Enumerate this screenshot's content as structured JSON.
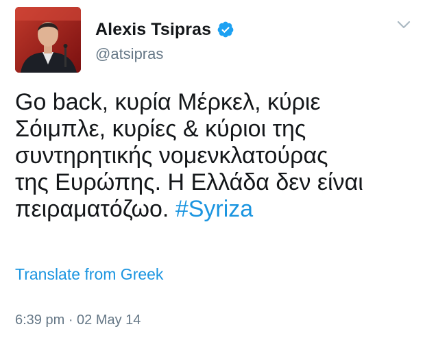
{
  "user": {
    "display_name": "Alexis Tsipras",
    "handle": "@atsipras",
    "verified": true
  },
  "tweet": {
    "lines": [
      "Go back, κυρία Μέρκελ, κύριε",
      "Σόιμπλε, κυρίες & κύριοι της",
      "συντηρητικής νομενκλατούρας",
      "της Ευρώπης. Η Ελλάδα δεν είναι"
    ],
    "last_line_text": "πειραματόζωο. ",
    "hashtag": "#Syriza"
  },
  "translate_label": "Translate from Greek",
  "timestamp": "6:39 pm · 02 May 14",
  "colors": {
    "link": "#1b95e0",
    "muted": "#657786",
    "text": "#14171a"
  },
  "icons": {
    "verified": "verified-badge-icon",
    "menu": "chevron-down-icon"
  }
}
